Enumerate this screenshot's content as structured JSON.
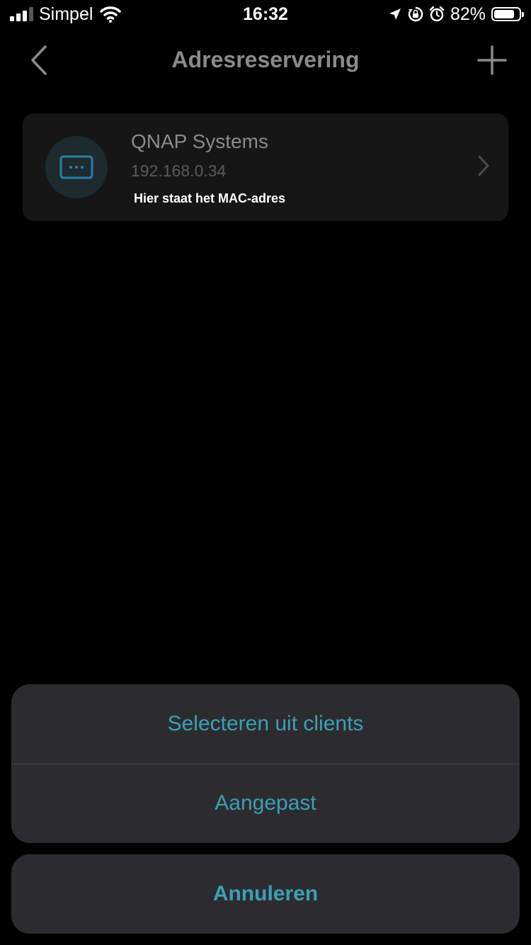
{
  "status_bar": {
    "carrier": "Simpel",
    "time": "16:32",
    "battery_percent": "82%",
    "battery_level": 0.82,
    "icons": [
      "signal-icon",
      "wifi-icon",
      "location-icon",
      "rotation-lock-icon",
      "alarm-icon",
      "battery-icon"
    ]
  },
  "nav": {
    "title": "Adresreservering",
    "back_icon": "chevron-left-icon",
    "add_icon": "plus-icon"
  },
  "reservations": [
    {
      "name": "QNAP Systems",
      "ip": "192.168.0.34",
      "mac": "Hier staat het MAC-adres",
      "icon": "device-icon"
    }
  ],
  "action_sheet": {
    "options": [
      "Selecteren uit clients",
      "Aangepast"
    ],
    "cancel": "Annuleren"
  },
  "colors": {
    "accent": "#3aa0b5",
    "background": "#000000",
    "sheet": "#2c2c30",
    "card": "#161616"
  }
}
